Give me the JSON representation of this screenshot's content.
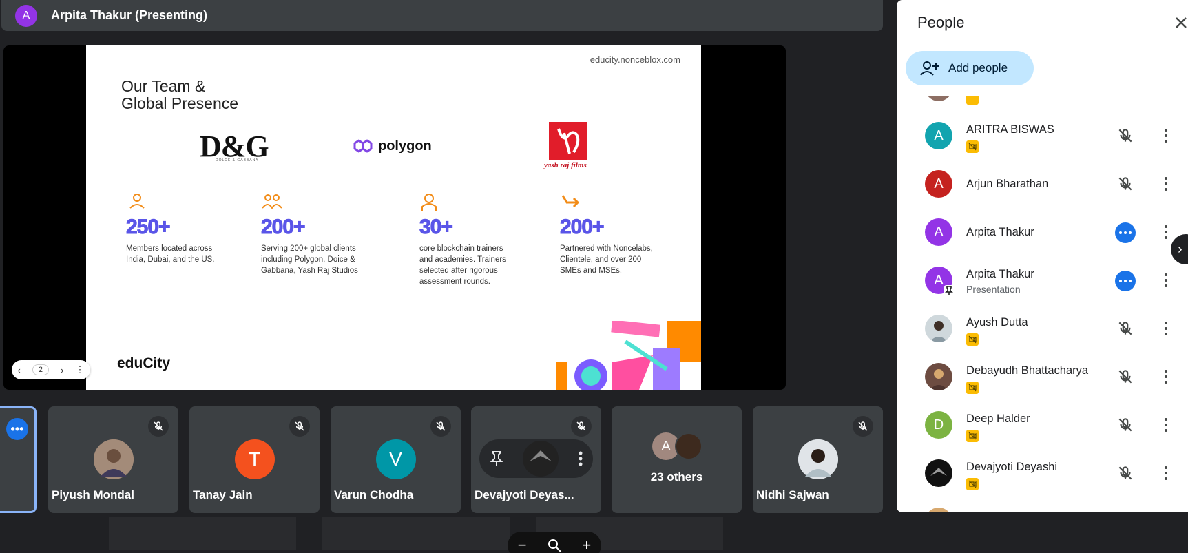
{
  "header": {
    "avatar_letter": "A",
    "presenter": "Arpita Thakur (Presenting)"
  },
  "slide": {
    "url": "educity.nonceblox.com",
    "title_line1": "Our Team &",
    "title_line2": "Global Presence",
    "logos": {
      "dg": "D&G",
      "dg_sub": "DOLCE & GABBANA",
      "polygon": "polygon",
      "yrf": "yash raj films"
    },
    "stats": [
      {
        "num": "250+",
        "desc": "Members located across\nIndia, Dubai, and the US."
      },
      {
        "num": "200+",
        "desc": "Serving 200+ global clients\nincluding Polygon, Doice &\nGabbana, Yash Raj Studios"
      },
      {
        "num": "30+",
        "desc": "core blockchain trainers\nand academies. Trainers\nselected after rigorous\nassessment rounds."
      },
      {
        "num": "200+",
        "desc": "Partnered with Noncelabs,\nClientele, and over 200\nSMEs and MSEs."
      }
    ],
    "brand": {
      "main": "eduCity"
    },
    "page_number": "2"
  },
  "tiles": [
    {
      "name": "Piyush Mondal"
    },
    {
      "name": "Tanay Jain",
      "letter": "T",
      "color": "#f4511e"
    },
    {
      "name": "Varun Chodha",
      "letter": "V",
      "color": "#0097a7"
    },
    {
      "name": "Devajyoti Deyas..."
    },
    {
      "name": "23 others",
      "letter": "A"
    },
    {
      "name": "Nidhi Sajwan"
    }
  ],
  "people_panel": {
    "title": "People",
    "add_label": "Add people",
    "people": [
      {
        "name": "ARITRA BISWAS",
        "letter": "A",
        "color": "#12a4af",
        "status": "muted"
      },
      {
        "name": "Arjun Bharathan",
        "letter": "A",
        "color": "#c5221f",
        "status": "muted"
      },
      {
        "name": "Arpita Thakur",
        "letter": "A",
        "color": "#9334e6",
        "status": "more"
      },
      {
        "name": "Arpita Thakur",
        "sub": "Presentation",
        "letter": "A",
        "color": "#9334e6",
        "status": "more"
      },
      {
        "name": "Ayush Dutta",
        "status": "muted"
      },
      {
        "name": "Debayudh Bhattacharya",
        "status": "muted"
      },
      {
        "name": "Deep Halder",
        "letter": "D",
        "color": "#7cb342",
        "status": "muted"
      },
      {
        "name": "Devajyoti Deyashi",
        "status": "muted"
      }
    ]
  },
  "icons": {
    "close": "close-icon",
    "add_person": "person-add-icon",
    "mic_off": "mic-off-icon",
    "more": "more-vert-icon",
    "pin": "pin-icon",
    "zoom": "zoom-icon"
  }
}
